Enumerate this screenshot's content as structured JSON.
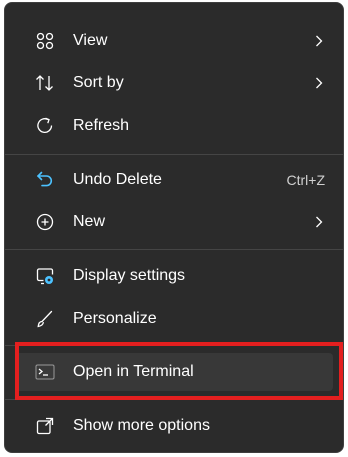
{
  "menu": {
    "items": [
      {
        "label": "View",
        "icon": "view-grid-icon",
        "submenu": true
      },
      {
        "label": "Sort by",
        "icon": "sort-arrows-icon",
        "submenu": true
      },
      {
        "label": "Refresh",
        "icon": "refresh-icon",
        "submenu": false
      },
      {
        "label": "Undo Delete",
        "icon": "undo-icon",
        "shortcut": "Ctrl+Z"
      },
      {
        "label": "New",
        "icon": "new-plus-icon",
        "submenu": true
      },
      {
        "label": "Display settings",
        "icon": "display-settings-icon"
      },
      {
        "label": "Personalize",
        "icon": "personalize-brush-icon"
      },
      {
        "label": "Open in Terminal",
        "icon": "terminal-icon",
        "highlighted": true
      },
      {
        "label": "Show more options",
        "icon": "show-more-options-icon"
      }
    ]
  },
  "colors": {
    "menu_bg": "#2b2b2b",
    "separator": "#454545",
    "highlight_border": "#e41f1f",
    "accent_blue": "#4cc2ff"
  }
}
